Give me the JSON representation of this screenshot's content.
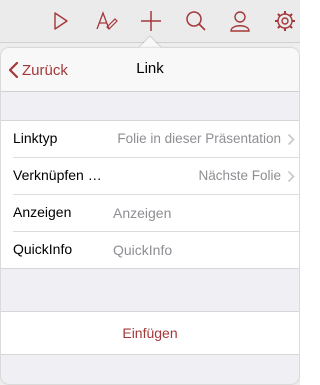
{
  "toolbar": {
    "icons": [
      "play-icon",
      "draw-pen-icon",
      "add-plus-icon",
      "search-icon",
      "person-icon",
      "gear-icon"
    ],
    "icon_color": "#a4373a"
  },
  "popover": {
    "back_label": "Zurück",
    "title": "Link",
    "rows": [
      {
        "label": "Linktyp",
        "value": "Folie in dieser Präsentation"
      },
      {
        "label": "Verknüpfen …",
        "value": "Nächste Folie"
      },
      {
        "label": "Anzeigen",
        "placeholder": "Anzeigen"
      },
      {
        "label": "QuickInfo",
        "placeholder": "QuickInfo"
      }
    ],
    "insert_label": "Einfügen"
  },
  "colors": {
    "accent": "#a4373a",
    "secondary_text": "#8e8e93",
    "group_background": "#efeff4"
  }
}
